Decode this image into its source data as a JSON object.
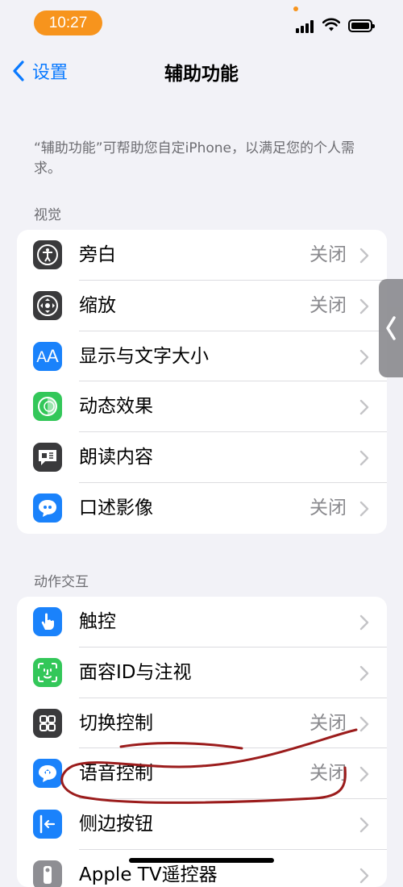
{
  "status_bar": {
    "time": "10:27"
  },
  "nav": {
    "back_label": "设置",
    "title": "辅助功能"
  },
  "description": "“辅助功能”可帮助您自定iPhone，以满足您的个人需求。",
  "sections": [
    {
      "header": "视觉",
      "rows": [
        {
          "label": "旁白",
          "value": "关闭",
          "icon": "voiceover-icon",
          "color": "#3a3a3c"
        },
        {
          "label": "缩放",
          "value": "关闭",
          "icon": "zoom-icon",
          "color": "#3a3a3c"
        },
        {
          "label": "显示与文字大小",
          "value": "",
          "icon": "text-size-icon",
          "color": "#1a82fb"
        },
        {
          "label": "动态效果",
          "value": "",
          "icon": "motion-icon",
          "color": "#33c759"
        },
        {
          "label": "朗读内容",
          "value": "",
          "icon": "spoken-content-icon",
          "color": "#3a3a3c"
        },
        {
          "label": "口述影像",
          "value": "关闭",
          "icon": "audio-description-icon",
          "color": "#1a82fb"
        }
      ]
    },
    {
      "header": "动作交互",
      "rows": [
        {
          "label": "触控",
          "value": "",
          "icon": "touch-icon",
          "color": "#1a82fb"
        },
        {
          "label": "面容ID与注视",
          "value": "",
          "icon": "face-id-icon",
          "color": "#33c759"
        },
        {
          "label": "切换控制",
          "value": "关闭",
          "icon": "switch-control-icon",
          "color": "#3a3a3c"
        },
        {
          "label": "语音控制",
          "value": "关闭",
          "icon": "voice-control-icon",
          "color": "#1a82fb"
        },
        {
          "label": "侧边按钮",
          "value": "",
          "icon": "side-button-icon",
          "color": "#1a82fb"
        },
        {
          "label": "Apple TV遥控器",
          "value": "",
          "icon": "apple-tv-remote-icon",
          "color": "#8e8e93"
        }
      ]
    }
  ],
  "annotation_color": "#9b1c1c"
}
